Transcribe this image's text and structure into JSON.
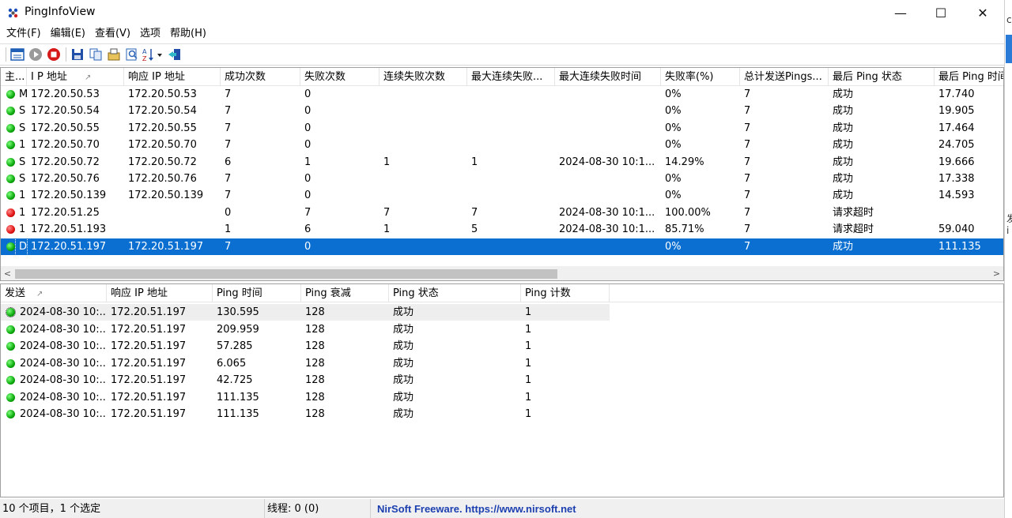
{
  "window": {
    "title": "PingInfoView",
    "minimize_glyph": "—",
    "maximize_glyph": "☐",
    "close_glyph": "✕"
  },
  "menu": [
    "文件(F)",
    "编辑(E)",
    "查看(V)",
    "选项",
    "帮助(H)"
  ],
  "toolbar": {
    "icons": [
      "properties-icon",
      "start-icon",
      "stop-icon",
      "save-icon",
      "copy-icon",
      "options-icon",
      "find-icon",
      "sort-icon",
      "exit-icon"
    ]
  },
  "upper": {
    "columns": [
      "主...",
      "I P 地址",
      "响应 IP 地址",
      "成功次数",
      "失败次数",
      "连续失败次数",
      "最大连续失败...",
      "最大连续失败时间",
      "失败率(%)",
      "总计发送Pings...",
      "最后 Ping 状态",
      "最后 Ping 时间"
    ],
    "sort_glyph": "↗",
    "rows": [
      {
        "status": "green",
        "host": "M",
        "ip": "172.20.50.53",
        "resp": "172.20.50.53",
        "succ": "7",
        "fail": "0",
        "consec": "",
        "maxconsec": "",
        "maxtime": "",
        "rate": "0%",
        "total": "7",
        "last": "成功",
        "lasttime": "17.740"
      },
      {
        "status": "green",
        "host": "S",
        "ip": "172.20.50.54",
        "resp": "172.20.50.54",
        "succ": "7",
        "fail": "0",
        "consec": "",
        "maxconsec": "",
        "maxtime": "",
        "rate": "0%",
        "total": "7",
        "last": "成功",
        "lasttime": "19.905"
      },
      {
        "status": "green",
        "host": "S",
        "ip": "172.20.50.55",
        "resp": "172.20.50.55",
        "succ": "7",
        "fail": "0",
        "consec": "",
        "maxconsec": "",
        "maxtime": "",
        "rate": "0%",
        "total": "7",
        "last": "成功",
        "lasttime": "17.464"
      },
      {
        "status": "green",
        "host": "1",
        "ip": "172.20.50.70",
        "resp": "172.20.50.70",
        "succ": "7",
        "fail": "0",
        "consec": "",
        "maxconsec": "",
        "maxtime": "",
        "rate": "0%",
        "total": "7",
        "last": "成功",
        "lasttime": "24.705"
      },
      {
        "status": "green",
        "host": "S",
        "ip": "172.20.50.72",
        "resp": "172.20.50.72",
        "succ": "6",
        "fail": "1",
        "consec": "1",
        "maxconsec": "1",
        "maxtime": "2024-08-30 10:1...",
        "rate": "14.29%",
        "total": "7",
        "last": "成功",
        "lasttime": "19.666"
      },
      {
        "status": "green",
        "host": "S",
        "ip": "172.20.50.76",
        "resp": "172.20.50.76",
        "succ": "7",
        "fail": "0",
        "consec": "",
        "maxconsec": "",
        "maxtime": "",
        "rate": "0%",
        "total": "7",
        "last": "成功",
        "lasttime": "17.338"
      },
      {
        "status": "green",
        "host": "1",
        "ip": "172.20.50.139",
        "resp": "172.20.50.139",
        "succ": "7",
        "fail": "0",
        "consec": "",
        "maxconsec": "",
        "maxtime": "",
        "rate": "0%",
        "total": "7",
        "last": "成功",
        "lasttime": "14.593"
      },
      {
        "status": "red",
        "host": "1",
        "ip": "172.20.51.25",
        "resp": "",
        "succ": "0",
        "fail": "7",
        "consec": "7",
        "maxconsec": "7",
        "maxtime": "2024-08-30 10:1...",
        "rate": "100.00%",
        "total": "7",
        "last": "请求超时",
        "lasttime": ""
      },
      {
        "status": "red",
        "host": "1",
        "ip": "172.20.51.193",
        "resp": "",
        "succ": "1",
        "fail": "6",
        "consec": "1",
        "maxconsec": "5",
        "maxtime": "2024-08-30 10:1...",
        "rate": "85.71%",
        "total": "7",
        "last": "请求超时",
        "lasttime": "59.040"
      },
      {
        "status": "green",
        "host": "D",
        "ip": "172.20.51.197",
        "resp": "172.20.51.197",
        "succ": "7",
        "fail": "0",
        "consec": "",
        "maxconsec": "",
        "maxtime": "",
        "rate": "0%",
        "total": "7",
        "last": "成功",
        "lasttime": "111.135",
        "selected": true
      }
    ],
    "scroll_left": "<",
    "scroll_right": ">"
  },
  "lower": {
    "columns": [
      "发送",
      "响应 IP 地址",
      "Ping 时间",
      "Ping 衰减",
      "Ping 状态",
      "Ping 计数"
    ],
    "sort_glyph": "↗",
    "rows": [
      {
        "sent": "2024-08-30 10:...",
        "resp": "172.20.51.197",
        "time": "130.595",
        "ttl": "128",
        "status": "成功",
        "count": "1"
      },
      {
        "sent": "2024-08-30 10:...",
        "resp": "172.20.51.197",
        "time": "209.959",
        "ttl": "128",
        "status": "成功",
        "count": "1"
      },
      {
        "sent": "2024-08-30 10:...",
        "resp": "172.20.51.197",
        "time": "57.285",
        "ttl": "128",
        "status": "成功",
        "count": "1"
      },
      {
        "sent": "2024-08-30 10:...",
        "resp": "172.20.51.197",
        "time": "6.065",
        "ttl": "128",
        "status": "成功",
        "count": "1"
      },
      {
        "sent": "2024-08-30 10:...",
        "resp": "172.20.51.197",
        "time": "42.725",
        "ttl": "128",
        "status": "成功",
        "count": "1"
      },
      {
        "sent": "2024-08-30 10:...",
        "resp": "172.20.51.197",
        "time": "111.135",
        "ttl": "128",
        "status": "成功",
        "count": "1"
      },
      {
        "sent": "2024-08-30 10:...",
        "resp": "172.20.51.197",
        "time": "111.135",
        "ttl": "128",
        "status": "成功",
        "count": "1"
      }
    ]
  },
  "statusbar": {
    "items": "10 个项目，1 个选定",
    "threads": "线程: 0 (0)",
    "credit": "NirSoft Freeware. https://www.nirsoft.net"
  },
  "background_app": {
    "glyph_top": "ce",
    "glyph_mid": "发i"
  }
}
